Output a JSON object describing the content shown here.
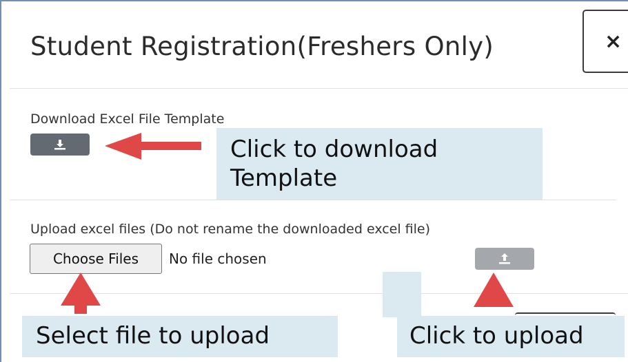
{
  "modal": {
    "title": "Student Registration(Freshers Only)",
    "close_label": "×"
  },
  "download": {
    "label": "Download Excel File Template",
    "button_icon": "download-icon"
  },
  "upload": {
    "label": "Upload excel files (Do not rename the downloaded excel file)",
    "choose_label": "Choose Files",
    "no_file_text": "No file chosen",
    "button_icon": "upload-icon"
  },
  "annotations": {
    "download_callout": "Click to download Template",
    "select_callout": "Select file to upload",
    "upload_callout": "Click to upload"
  },
  "colors": {
    "arrow": "#e04848",
    "callout_bg": "#dbe9f1",
    "download_button": "#636a72",
    "upload_button": "#a4a8ad"
  }
}
